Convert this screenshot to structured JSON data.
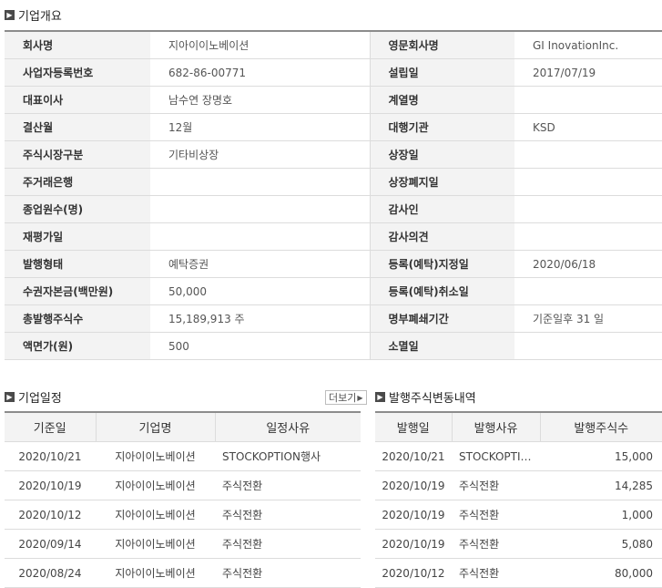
{
  "overview": {
    "title": "기업개요",
    "rows": [
      {
        "k1": "회사명",
        "v1": "지아이이노베이션",
        "k2": "영문회사명",
        "v2": "GI InovationInc."
      },
      {
        "k1": "사업자등록번호",
        "v1": "682-86-00771",
        "k2": "설립일",
        "v2": "2017/07/19"
      },
      {
        "k1": "대표이사",
        "v1": "남수연 장명호",
        "k2": "계열명",
        "v2": ""
      },
      {
        "k1": "결산월",
        "v1": "12월",
        "k2": "대행기관",
        "v2": "KSD"
      },
      {
        "k1": "주식시장구분",
        "v1": "기타비상장",
        "k2": "상장일",
        "v2": ""
      },
      {
        "k1": "주거래은행",
        "v1": "",
        "k2": "상장폐지일",
        "v2": ""
      },
      {
        "k1": "종업원수(명)",
        "v1": "",
        "k2": "감사인",
        "v2": ""
      },
      {
        "k1": "재평가일",
        "v1": "",
        "k2": "감사의견",
        "v2": ""
      },
      {
        "k1": "발행형태",
        "v1": "예탁증권",
        "k2": "등록(예탁)지정일",
        "v2": "2020/06/18"
      },
      {
        "k1": "수권자본금(백만원)",
        "v1": "50,000",
        "k2": "등록(예탁)취소일",
        "v2": ""
      },
      {
        "k1": "총발행주식수",
        "v1": "15,189,913 주",
        "k2": "명부폐쇄기간",
        "v2": "기준일후 31 일"
      },
      {
        "k1": "액면가(원)",
        "v1": "500",
        "k2": "소멸일",
        "v2": ""
      }
    ]
  },
  "schedule": {
    "title": "기업일정",
    "more_label": "더보기",
    "columns": [
      "기준일",
      "기업명",
      "일정사유"
    ],
    "rows": [
      [
        "2020/10/21",
        "지아이이노베이션",
        "STOCKOPTION행사"
      ],
      [
        "2020/10/19",
        "지아이이노베이션",
        "주식전환"
      ],
      [
        "2020/10/12",
        "지아이이노베이션",
        "주식전환"
      ],
      [
        "2020/09/14",
        "지아이이노베이션",
        "주식전환"
      ],
      [
        "2020/08/24",
        "지아이이노베이션",
        "주식전환"
      ]
    ]
  },
  "issuance": {
    "title": "발행주식변동내역",
    "columns": [
      "발행일",
      "발행사유",
      "발행주식수"
    ],
    "rows": [
      [
        "2020/10/21",
        "STOCKOPTI…",
        "15,000"
      ],
      [
        "2020/10/19",
        "주식전환",
        "14,285"
      ],
      [
        "2020/10/19",
        "주식전환",
        "1,000"
      ],
      [
        "2020/10/19",
        "주식전환",
        "5,080"
      ],
      [
        "2020/10/12",
        "주식전환",
        "80,000"
      ]
    ]
  },
  "icons": {
    "section": "arrow-right-box-icon",
    "more": "chevron-right-icon"
  }
}
